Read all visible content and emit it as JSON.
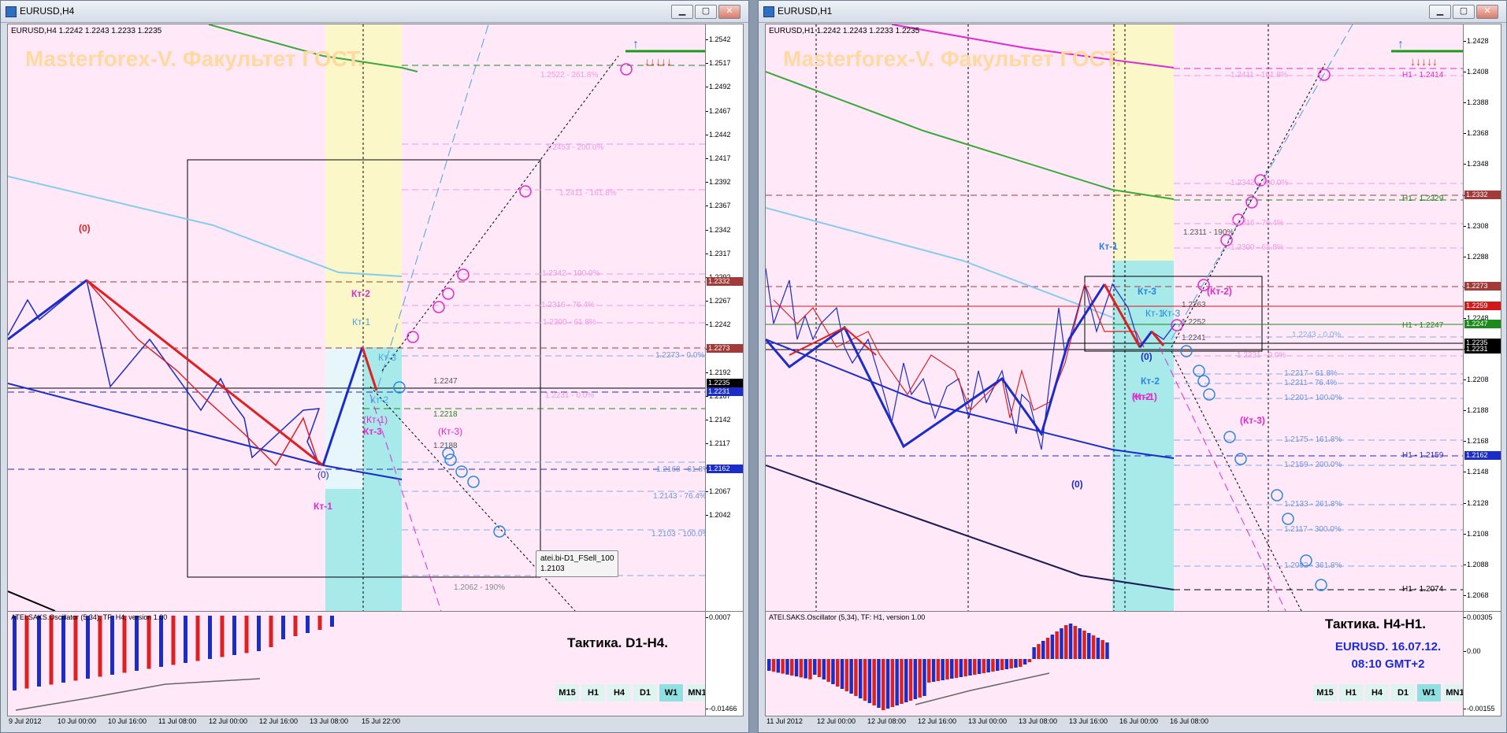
{
  "left_window": {
    "title": "EURUSD,H4",
    "symbol_line": "EURUSD,H4  1.2242 1.2243 1.2233 1.2235",
    "watermark": "Masterforex-V. Факультет ГОСТ.",
    "price_ticks": [
      "1.2542",
      "1.2517",
      "1.2492",
      "1.2467",
      "1.2442",
      "1.2417",
      "1.2392",
      "1.2367",
      "1.2342",
      "1.2317",
      "1.2292",
      "1.2267",
      "1.2242",
      "1.2217",
      "1.2192",
      "1.2167",
      "1.2142",
      "1.2117",
      "1.2092",
      "1.2067",
      "1.2042"
    ],
    "price_tags": [
      {
        "text": "1.2332",
        "color": "#a33a3a"
      },
      {
        "text": "1.2273",
        "color": "#a33a3a"
      },
      {
        "text": "1.2235",
        "color": "#000000"
      },
      {
        "text": "1.2231",
        "color": "#1c2cc8"
      },
      {
        "text": "1.2162",
        "color": "#1c2cc8"
      }
    ],
    "fib_labels": [
      "1.2522 - 261.8%",
      "1.2453 - 200.0%",
      "1.2411 - 161.8%",
      "1.2342 - 100.0%",
      "1.2316 - 76.4%",
      "1.2300 - 61.8%",
      "1.2273 - 0.0%",
      "1.2231 - 0.0%",
      "1.2168 - 61.8%",
      "1.2143 - 76.4%",
      "1.2103 - 100.0%",
      "1.2062 - 190%"
    ],
    "level_labels": [
      "1.2247",
      "1.2218",
      "1.2188"
    ],
    "wave_labels": [
      "(0)",
      "Кт-2",
      "Кт-1",
      "Кт-3",
      "Кт-2",
      "(Кт-1)",
      "Кт-3",
      "(Кт-3)",
      "(0)",
      "Кт-1"
    ],
    "tooltip": {
      "line1": "atei.bi-D1_FSell_100",
      "line2": "1.2103"
    },
    "osc_label": "ATEI.SAKS.Oscillator (5,34), TF: H4, version 1.00",
    "osc_scale": [
      "0.0007",
      "0.00",
      "-0.01466"
    ],
    "tactic": "Тактика. D1-H4.",
    "timeframes": [
      "M15",
      "H1",
      "H4",
      "D1",
      "W1",
      "MN1"
    ],
    "time_labels": [
      "9 Jul 2012",
      "10 Jul 00:00",
      "10 Jul 16:00",
      "11 Jul 08:00",
      "12 Jul 00:00",
      "12 Jul 16:00",
      "13 Jul 08:00",
      "15 Jul 22:00"
    ]
  },
  "right_window": {
    "title": "EURUSD,H1",
    "symbol_line": "EURUSD,H1  1.2242 1.2243 1.2233 1.2235",
    "watermark": "Masterforex-V. Факультет ГОСТ.",
    "price_ticks": [
      "1.2428",
      "1.2408",
      "1.2388",
      "1.2368",
      "1.2348",
      "1.2328",
      "1.2308",
      "1.2288",
      "1.2268",
      "1.2248",
      "1.2228",
      "1.2208",
      "1.2188",
      "1.2168",
      "1.2148",
      "1.2128",
      "1.2108",
      "1.2088",
      "1.2068"
    ],
    "price_tags": [
      {
        "text": "1.2332",
        "color": "#a33a3a"
      },
      {
        "text": "1.2273",
        "color": "#a33a3a"
      },
      {
        "text": "1.2259",
        "color": "#d01a1a"
      },
      {
        "text": "1.2247",
        "color": "#1c8a1c"
      },
      {
        "text": "1.2235",
        "color": "#000000"
      },
      {
        "text": "1.2231",
        "color": "#000000"
      },
      {
        "text": "1.2162",
        "color": "#1c2cc8"
      }
    ],
    "fib_labels": [
      "1.2411 - 161.8%",
      "1.2342 - 100.0%",
      "1.2316 - 76.4%",
      "1.2300 - 61.8%",
      "1.2243 - 0.0%",
      "1.2231 - 0.0%",
      "1.2217 - 61.8%",
      "1.2211 - 76.4%",
      "1.2201 - 100.0%",
      "1.2175 - 161.8%",
      "1.2159 - 200.0%",
      "1.2133 - 261.8%",
      "1.2117 - 300.0%",
      "1.2092 - 361.8%"
    ],
    "h1_labels": [
      "H1 - 1.2414",
      "H1 - 1.2329",
      "H1 - 1.2247",
      "H1 - 1.2159",
      "H1 - 1.2074"
    ],
    "level_labels": [
      "1.2311 - 190%",
      "1.2263",
      "1.2252",
      "1.2241"
    ],
    "wave_labels": [
      "Кт-1",
      "Кт-3",
      "(Кт-2)",
      "Кт-1",
      "Кт-3",
      "(0)",
      "Кт-2",
      "Кт-2",
      "(Кт-1)",
      "(Кт-3)",
      "(0)"
    ],
    "osc_label": "ATEI.SAKS.Oscillator (5,34), TF: H1, version 1.00",
    "osc_scale": [
      "0.00305",
      "0.00",
      "-0.00155"
    ],
    "tactic": "Тактика. H4-H1.",
    "info_line1": "EURUSD. 16.07.12.",
    "info_line2": "08:10  GMT+2",
    "timeframes": [
      "M15",
      "H1",
      "H4",
      "D1",
      "W1",
      "MN1"
    ],
    "time_labels": [
      "11 Jul 2012",
      "12 Jul 00:00",
      "12 Jul 08:00",
      "12 Jul 16:00",
      "13 Jul 00:00",
      "13 Jul 08:00",
      "13 Jul 16:00",
      "16 Jul 00:00",
      "16 Jul 08:00"
    ]
  },
  "colors": {
    "chart_bg": "#ffe8f8",
    "bull": "#1c2cc8",
    "bear": "#e02020",
    "magenta": "#e02ad0",
    "yellow_zone": "#fbf7c8",
    "cyan_zone": "#a8e9ea"
  }
}
